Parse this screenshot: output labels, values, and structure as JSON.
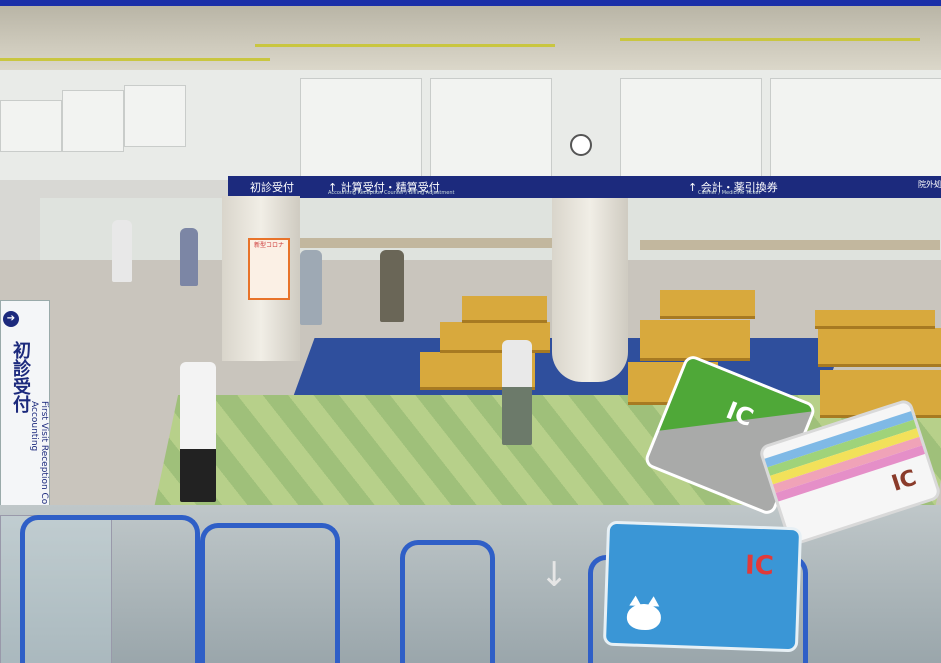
{
  "signs": {
    "first_visit": "初診受付",
    "first_visit_en": "First Visit Reception Counter",
    "accounting": "↑ 計算受付・精算受付",
    "accounting_en": "Accounting Reception Counter / Billing Adjustment",
    "cashier": "↑ 会計・薬引換券",
    "cashier_en": "Cashier / Medicine Ticket",
    "right_edge": "院外処",
    "stand_jp": "初診受付",
    "stand_en": "First Visit Reception Counter Accounting",
    "stand_en_tail": "nter",
    "poster_text": "新型コロナ"
  },
  "cards": {
    "green_label": "IC",
    "rainbow_label": "IC",
    "blue_label": "IC",
    "rainbow_colors": [
      "#7fb9e6",
      "#9fd37a",
      "#f2e15a",
      "#f0a3b8",
      "#e58fc8"
    ]
  },
  "colors": {
    "sign_navy": "#1c2a7d",
    "escalator_blue": "#2f5fc7",
    "bench_yellow": "#d8a93d",
    "carpet_blue": "#2f4f9d",
    "carpet_green": "#9fc07a"
  }
}
